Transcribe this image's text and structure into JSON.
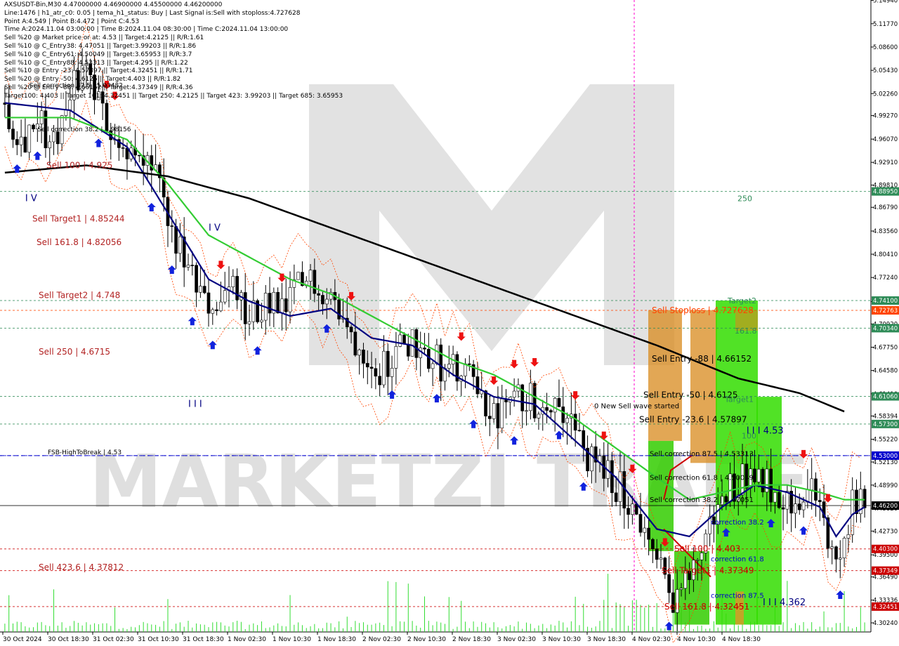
{
  "header_lines": [
    "AXSUSDT-Bin,M30  4.47000000 4.46900000 4.45500000 4.46200000",
    "Line:1476 | h1_atr_c0: 0.05 | tema_h1_status: Buy | Last Signal is:Sell with stoploss:4.727628",
    "Point A:4.549 | Point B:4.472 | Point C:4.53",
    "Time A:2024.11.04 03:00:00 | Time B:2024.11.04 08:30:00 | Time C:2024.11.04 13:00:00",
    "Sell %20 @ Market price or at: 4.53 || Target:4.2125 || R/R:1.61",
    "Sell %10 @ C_Entry38: 4.47051 || Target:3.99203 || R/R:1.86",
    "Sell %10 @ C_Entry61: 4.50049 || Target:3.65953 || R/R:3.7",
    "Sell %10 @ C_Entry88: 4.53313 || Target:4.295 || R/R:1.22",
    "Sell %10 @ Entry -23: 4.57897 || Target:4.32451 || R/R:1.71",
    "Sell %20 @ Entry -50: 4.6125 || Target:4.403 || R/R:1.82",
    "Sell %20 @ Entry -88: 4.66152 || Target:4.37349 || R/R:4.36",
    "Target100: 4.403 || Target 161: 4.32451 || Target 250: 4.2125 || Target 423: 3.99203 || Target 685: 3.65953"
  ],
  "watermark": "MARKETZI TRADE",
  "chart_data": {
    "type": "line",
    "title": "AXSUSDT-Bin,M30",
    "ohlc_last": {
      "open": 4.47,
      "high": 4.469,
      "low": 4.455,
      "close": 4.462
    },
    "ylim": [
      4.29,
      5.15
    ],
    "y_ticks": [
      5.1494,
      5.1177,
      5.086,
      5.0543,
      5.0226,
      4.9927,
      4.9607,
      4.9291,
      4.8981,
      4.8679,
      4.8356,
      4.8041,
      4.7724,
      4.7396,
      4.7092,
      4.6775,
      4.6458,
      4.6141,
      4.58394,
      4.5522,
      4.5213,
      4.4899,
      4.4582,
      4.4273,
      4.395,
      4.3649,
      4.33336,
      4.3024
    ],
    "x_ticks": [
      "30 Oct 2024",
      "30 Oct 18:30",
      "31 Oct 02:30",
      "31 Oct 10:30",
      "31 Oct 18:30",
      "1 Nov 02:30",
      "1 Nov 10:30",
      "1 Nov 18:30",
      "2 Nov 02:30",
      "2 Nov 10:30",
      "2 Nov 18:30",
      "3 Nov 02:30",
      "3 Nov 10:30",
      "3 Nov 18:30",
      "4 Nov 02:30",
      "4 Nov 10:30",
      "4 Nov 18:30"
    ],
    "price_anchors": [
      [
        0,
        5.01
      ],
      [
        4,
        4.96
      ],
      [
        8,
        4.99
      ],
      [
        12,
        4.95
      ],
      [
        16,
        5.03
      ],
      [
        20,
        5.06
      ],
      [
        24,
        4.99
      ],
      [
        28,
        4.96
      ],
      [
        32,
        4.93
      ],
      [
        36,
        4.92
      ],
      [
        40,
        4.85
      ],
      [
        44,
        4.79
      ],
      [
        48,
        4.74
      ],
      [
        52,
        4.73
      ],
      [
        56,
        4.76
      ],
      [
        60,
        4.71
      ],
      [
        64,
        4.74
      ],
      [
        68,
        4.72
      ],
      [
        72,
        4.76
      ],
      [
        76,
        4.77
      ],
      [
        80,
        4.75
      ],
      [
        84,
        4.7
      ],
      [
        88,
        4.68
      ],
      [
        92,
        4.65
      ],
      [
        96,
        4.67
      ],
      [
        100,
        4.69
      ],
      [
        104,
        4.67
      ],
      [
        108,
        4.65
      ],
      [
        112,
        4.64
      ],
      [
        116,
        4.62
      ],
      [
        120,
        4.58
      ],
      [
        124,
        4.6
      ],
      [
        128,
        4.61
      ],
      [
        132,
        4.6
      ],
      [
        136,
        4.61
      ],
      [
        140,
        4.56
      ],
      [
        144,
        4.52
      ],
      [
        148,
        4.5
      ],
      [
        152,
        4.48
      ],
      [
        156,
        4.44
      ],
      [
        160,
        4.38
      ],
      [
        164,
        4.34
      ],
      [
        168,
        4.36
      ],
      [
        172,
        4.42
      ],
      [
        176,
        4.47
      ],
      [
        180,
        4.5
      ],
      [
        184,
        4.51
      ],
      [
        188,
        4.49
      ],
      [
        192,
        4.47
      ],
      [
        196,
        4.48
      ],
      [
        200,
        4.47
      ],
      [
        204,
        4.37
      ],
      [
        208,
        4.46
      ],
      [
        211,
        4.462
      ]
    ],
    "series": [
      {
        "name": "tema",
        "color": "#000080",
        "values": [
          [
            0,
            5.01
          ],
          [
            16,
            5.0
          ],
          [
            30,
            4.95
          ],
          [
            40,
            4.86
          ],
          [
            50,
            4.77
          ],
          [
            60,
            4.74
          ],
          [
            70,
            4.72
          ],
          [
            80,
            4.73
          ],
          [
            90,
            4.69
          ],
          [
            100,
            4.68
          ],
          [
            110,
            4.64
          ],
          [
            120,
            4.61
          ],
          [
            130,
            4.6
          ],
          [
            140,
            4.55
          ],
          [
            150,
            4.5
          ],
          [
            160,
            4.43
          ],
          [
            168,
            4.42
          ],
          [
            176,
            4.46
          ],
          [
            184,
            4.49
          ],
          [
            192,
            4.48
          ],
          [
            200,
            4.46
          ],
          [
            204,
            4.42
          ],
          [
            208,
            4.45
          ],
          [
            211,
            4.46
          ]
        ]
      },
      {
        "name": "ema",
        "color": "#33cc33",
        "values": [
          [
            0,
            4.99
          ],
          [
            16,
            4.99
          ],
          [
            30,
            4.96
          ],
          [
            40,
            4.9
          ],
          [
            50,
            4.83
          ],
          [
            60,
            4.8
          ],
          [
            70,
            4.77
          ],
          [
            80,
            4.75
          ],
          [
            90,
            4.72
          ],
          [
            100,
            4.69
          ],
          [
            110,
            4.66
          ],
          [
            120,
            4.64
          ],
          [
            130,
            4.61
          ],
          [
            140,
            4.58
          ],
          [
            150,
            4.54
          ],
          [
            160,
            4.5
          ],
          [
            168,
            4.47
          ],
          [
            176,
            4.48
          ],
          [
            184,
            4.49
          ],
          [
            192,
            4.49
          ],
          [
            200,
            4.48
          ],
          [
            206,
            4.47
          ],
          [
            211,
            4.47
          ]
        ]
      },
      {
        "name": "sma",
        "color": "#000000",
        "values": [
          [
            0,
            4.915
          ],
          [
            20,
            4.925
          ],
          [
            40,
            4.91
          ],
          [
            60,
            4.88
          ],
          [
            80,
            4.84
          ],
          [
            100,
            4.8
          ],
          [
            120,
            4.76
          ],
          [
            140,
            4.72
          ],
          [
            160,
            4.68
          ],
          [
            180,
            4.635
          ],
          [
            195,
            4.615
          ],
          [
            206,
            4.59
          ]
        ]
      }
    ],
    "price_scale_labels": [
      {
        "value": 4.8895,
        "text": "4.88950",
        "color": "#2e8b57"
      },
      {
        "value": 4.741,
        "text": "4.74100",
        "color": "#2e8b57"
      },
      {
        "value": 4.72763,
        "text": "4.72763",
        "color": "#ff4500"
      },
      {
        "value": 4.7034,
        "text": "4.70340",
        "color": "#2e8b57"
      },
      {
        "value": 4.6106,
        "text": "4.61060",
        "color": "#2e8b57"
      },
      {
        "value": 4.573,
        "text": "4.57300",
        "color": "#2e8b57"
      },
      {
        "value": 4.53,
        "text": "4.53000",
        "color": "#0000cd"
      },
      {
        "value": 4.462,
        "text": "4.46200",
        "color": "#000000"
      },
      {
        "value": 4.403,
        "text": "4.40300",
        "color": "#cc0000"
      },
      {
        "value": 4.37349,
        "text": "4.37349",
        "color": "#cc0000"
      },
      {
        "value": 4.32451,
        "text": "4.32451",
        "color": "#cc0000"
      }
    ],
    "left_levels": [
      {
        "text": "Sell 100 | 4.925",
        "value": 4.925
      },
      {
        "text": "Sell Target1 | 4.85244",
        "value": 4.85244
      },
      {
        "text": "Sell 161.8 | 4.82056",
        "value": 4.82056
      },
      {
        "text": "Sell Target2 | 4.748",
        "value": 4.748
      },
      {
        "text": "Sell  250 | 4.6715",
        "value": 4.6715
      },
      {
        "text": "Sell  423.6 | 4.37812",
        "value": 4.37812
      }
    ],
    "right_levels": [
      {
        "text": "Sell Stoploss | 4.727628",
        "value": 4.727628,
        "color": "#ff4500"
      },
      {
        "text": "Sell Entry -88 | 4.66152",
        "value": 4.66152,
        "color": "#000000"
      },
      {
        "text": "Sell Entry -50 | 4.6125",
        "value": 4.6125,
        "color": "#000000"
      },
      {
        "text": "Sell Entry -23.6 | 4.57897",
        "value": 4.57897,
        "color": "#000000"
      },
      {
        "text": "Sell correction 87.5 | 4.53313",
        "value": 4.53313,
        "color": "#000000"
      },
      {
        "text": "Sell correction 61.8 | 4.50049",
        "value": 4.50049,
        "color": "#000000"
      },
      {
        "text": "Sell correction 38.2 | 4.47051",
        "value": 4.47051,
        "color": "#000000"
      },
      {
        "text": "Sell 100 | 4.403",
        "value": 4.403,
        "color": "#cc0000"
      },
      {
        "text": "Sell Target1 | 4.37349",
        "value": 4.37349,
        "color": "#cc0000"
      },
      {
        "text": "Sell 161.8 | 4.32451",
        "value": 4.32451,
        "color": "#cc0000"
      }
    ],
    "target_labels": [
      {
        "text": "250",
        "value": 4.88
      },
      {
        "text": "Target2",
        "value": 4.741
      },
      {
        "text": "161.8",
        "value": 4.7
      },
      {
        "text": "Target1",
        "value": 4.607
      },
      {
        "text": "100",
        "value": 4.557
      }
    ],
    "correction_labels": [
      {
        "text": "correction 38.2",
        "value": 4.44
      },
      {
        "text": "correction 61.8",
        "value": 4.39
      },
      {
        "text": "correction 87.5",
        "value": 4.34
      }
    ],
    "fsb_label": "FSB-HighToBreak | 4.53",
    "fsb_value": 4.53,
    "wave_label": "0 New Sell wave started",
    "wave_value": 4.598,
    "wave_marks": [
      {
        "text": "I V",
        "i": 5,
        "value": 4.88
      },
      {
        "text": "I V",
        "i": 50,
        "value": 4.84
      },
      {
        "text": "I I I",
        "i": 45,
        "value": 4.6
      },
      {
        "text": "I I I 4.53",
        "i": 182,
        "value": 4.564
      },
      {
        "text": "I I I 4.362",
        "i": 186,
        "value": 4.33
      },
      {
        "text": "Sell correction 38.2 | 4.98156",
        "i": 8,
        "value": 4.975
      },
      {
        "text": "Sell correction 87.5 | 5.03482",
        "i": 6,
        "value": 5.035
      }
    ],
    "sell_arrows": [
      25,
      27,
      53,
      68,
      85,
      112,
      120,
      125,
      130,
      140,
      147,
      154,
      162,
      196,
      202
    ],
    "buy_arrows": [
      3,
      8,
      23,
      36,
      41,
      46,
      51,
      62,
      79,
      95,
      106,
      115,
      125,
      136,
      142,
      163,
      177,
      188,
      196,
      205
    ]
  }
}
